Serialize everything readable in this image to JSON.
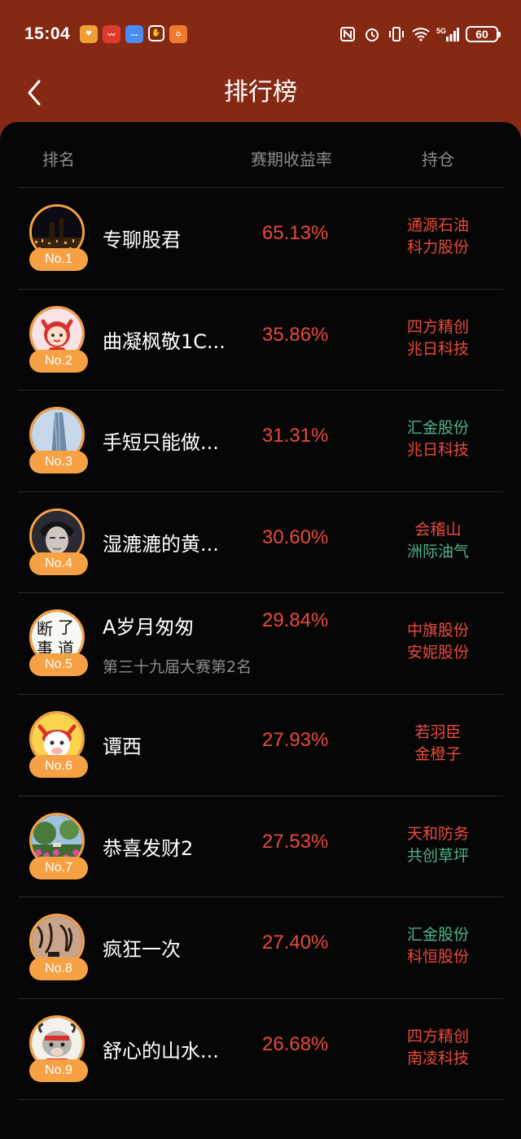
{
  "status": {
    "time": "15:04",
    "battery": "60",
    "network": "5G"
  },
  "nav": {
    "title": "排行榜"
  },
  "header": {
    "rank": "排名",
    "return": "赛期收益率",
    "holdings": "持仓"
  },
  "colors": {
    "up": "#e84a3c",
    "down": "#4fb38a",
    "badge": "#f7a145",
    "topbar": "#862914"
  },
  "rows": [
    {
      "rank": "No.1",
      "name": "专聊股君",
      "return": "65.13%",
      "avatar": "night-city-avatar",
      "stocks": [
        {
          "name": "通源石油",
          "color": "#e84a3c"
        },
        {
          "name": "科力股份",
          "color": "#e84a3c"
        }
      ]
    },
    {
      "rank": "No.2",
      "name": "曲凝枫敬1C...",
      "return": "35.86%",
      "avatar": "cartoon-devil-avatar",
      "stocks": [
        {
          "name": "四方精创",
          "color": "#e84a3c"
        },
        {
          "name": "兆日科技",
          "color": "#e84a3c"
        }
      ]
    },
    {
      "rank": "No.3",
      "name": "手短只能做...",
      "return": "31.31%",
      "avatar": "skyscraper-avatar",
      "stocks": [
        {
          "name": "汇金股份",
          "color": "#4fb38a"
        },
        {
          "name": "兆日科技",
          "color": "#e84a3c"
        }
      ]
    },
    {
      "rank": "No.4",
      "name": "湿漉漉的黄...",
      "return": "30.60%",
      "avatar": "portrait-avatar",
      "stocks": [
        {
          "name": "会稽山",
          "color": "#e84a3c"
        },
        {
          "name": "洲际油气",
          "color": "#4fb38a"
        }
      ]
    },
    {
      "rank": "No.5",
      "name": "A岁月匆匆",
      "subtitle": "第三十九届大赛第2名",
      "return": "29.84%",
      "avatar": "calligraphy-avatar",
      "stocks": [
        {
          "name": "中旗股份",
          "color": "#e84a3c"
        },
        {
          "name": "安妮股份",
          "color": "#e84a3c"
        }
      ]
    },
    {
      "rank": "No.6",
      "name": "谭西",
      "return": "27.93%",
      "avatar": "cartoon-ox-avatar",
      "stocks": [
        {
          "name": "若羽臣",
          "color": "#e84a3c"
        },
        {
          "name": "金橙子",
          "color": "#e84a3c"
        }
      ]
    },
    {
      "rank": "No.7",
      "name": "恭喜发财2",
      "return": "27.53%",
      "avatar": "flower-garden-avatar",
      "stocks": [
        {
          "name": "天和防务",
          "color": "#e84a3c"
        },
        {
          "name": "共创草坪",
          "color": "#4fb38a"
        }
      ]
    },
    {
      "rank": "No.8",
      "name": "疯狂一次",
      "return": "27.40%",
      "avatar": "ink-calligraphy-avatar",
      "stocks": [
        {
          "name": "汇金股份",
          "color": "#4fb38a"
        },
        {
          "name": "科恒股份",
          "color": "#e84a3c"
        }
      ]
    },
    {
      "rank": "No.9",
      "name": "舒心的山水...",
      "return": "26.68%",
      "avatar": "cartoon-bull-avatar",
      "stocks": [
        {
          "name": "四方精创",
          "color": "#e84a3c"
        },
        {
          "name": "南凌科技",
          "color": "#e84a3c"
        }
      ]
    }
  ]
}
